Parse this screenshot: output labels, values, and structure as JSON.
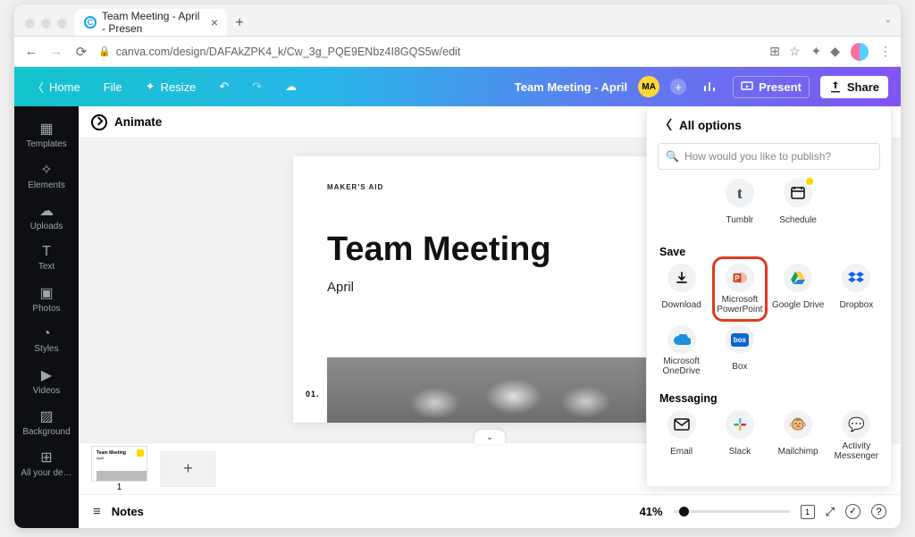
{
  "browser": {
    "tab_title": "Team Meeting - April - Presen",
    "url": "canva.com/design/DAFAkZPK4_k/Cw_3g_PQE9ENbz4I8GQS5w/edit"
  },
  "appbar": {
    "home": "Home",
    "file": "File",
    "resize": "Resize",
    "doc_title": "Team Meeting - April",
    "avatar": "MA",
    "present": "Present",
    "share": "Share"
  },
  "leftbar": {
    "items": [
      {
        "label": "Templates"
      },
      {
        "label": "Elements"
      },
      {
        "label": "Uploads"
      },
      {
        "label": "Text"
      },
      {
        "label": "Photos"
      },
      {
        "label": "Styles"
      },
      {
        "label": "Videos"
      },
      {
        "label": "Background"
      },
      {
        "label": "All your de…"
      }
    ]
  },
  "topstrip": {
    "animate": "Animate"
  },
  "slide": {
    "kicker": "MAKER'S AID",
    "title": "Team Meeting",
    "subtitle": "April",
    "num": "01."
  },
  "thumbs": {
    "n": "1",
    "t": "Team Meeting"
  },
  "bottom": {
    "notes": "Notes",
    "zoom": "41%",
    "pg": "1"
  },
  "panel": {
    "title": "All options",
    "search_ph": "How would you like to publish?",
    "row0": [
      {
        "label": "Tumblr",
        "icon": "t"
      },
      {
        "label": "Schedule",
        "icon": "cal",
        "badge": true
      }
    ],
    "save_title": "Save",
    "save_row1": [
      {
        "label": "Download",
        "icon": "dl"
      },
      {
        "label": "Microsoft PowerPoint",
        "icon": "ppt",
        "highlight": true
      },
      {
        "label": "Google Drive",
        "icon": "gdrive"
      },
      {
        "label": "Dropbox",
        "icon": "dbx"
      }
    ],
    "save_row2": [
      {
        "label": "Microsoft OneDrive",
        "icon": "od"
      },
      {
        "label": "Box",
        "icon": "box"
      }
    ],
    "msg_title": "Messaging",
    "msg_row": [
      {
        "label": "Email",
        "icon": "mail"
      },
      {
        "label": "Slack",
        "icon": "slack"
      },
      {
        "label": "Mailchimp",
        "icon": "mc"
      },
      {
        "label": "Activity Messenger",
        "icon": "am"
      }
    ]
  }
}
